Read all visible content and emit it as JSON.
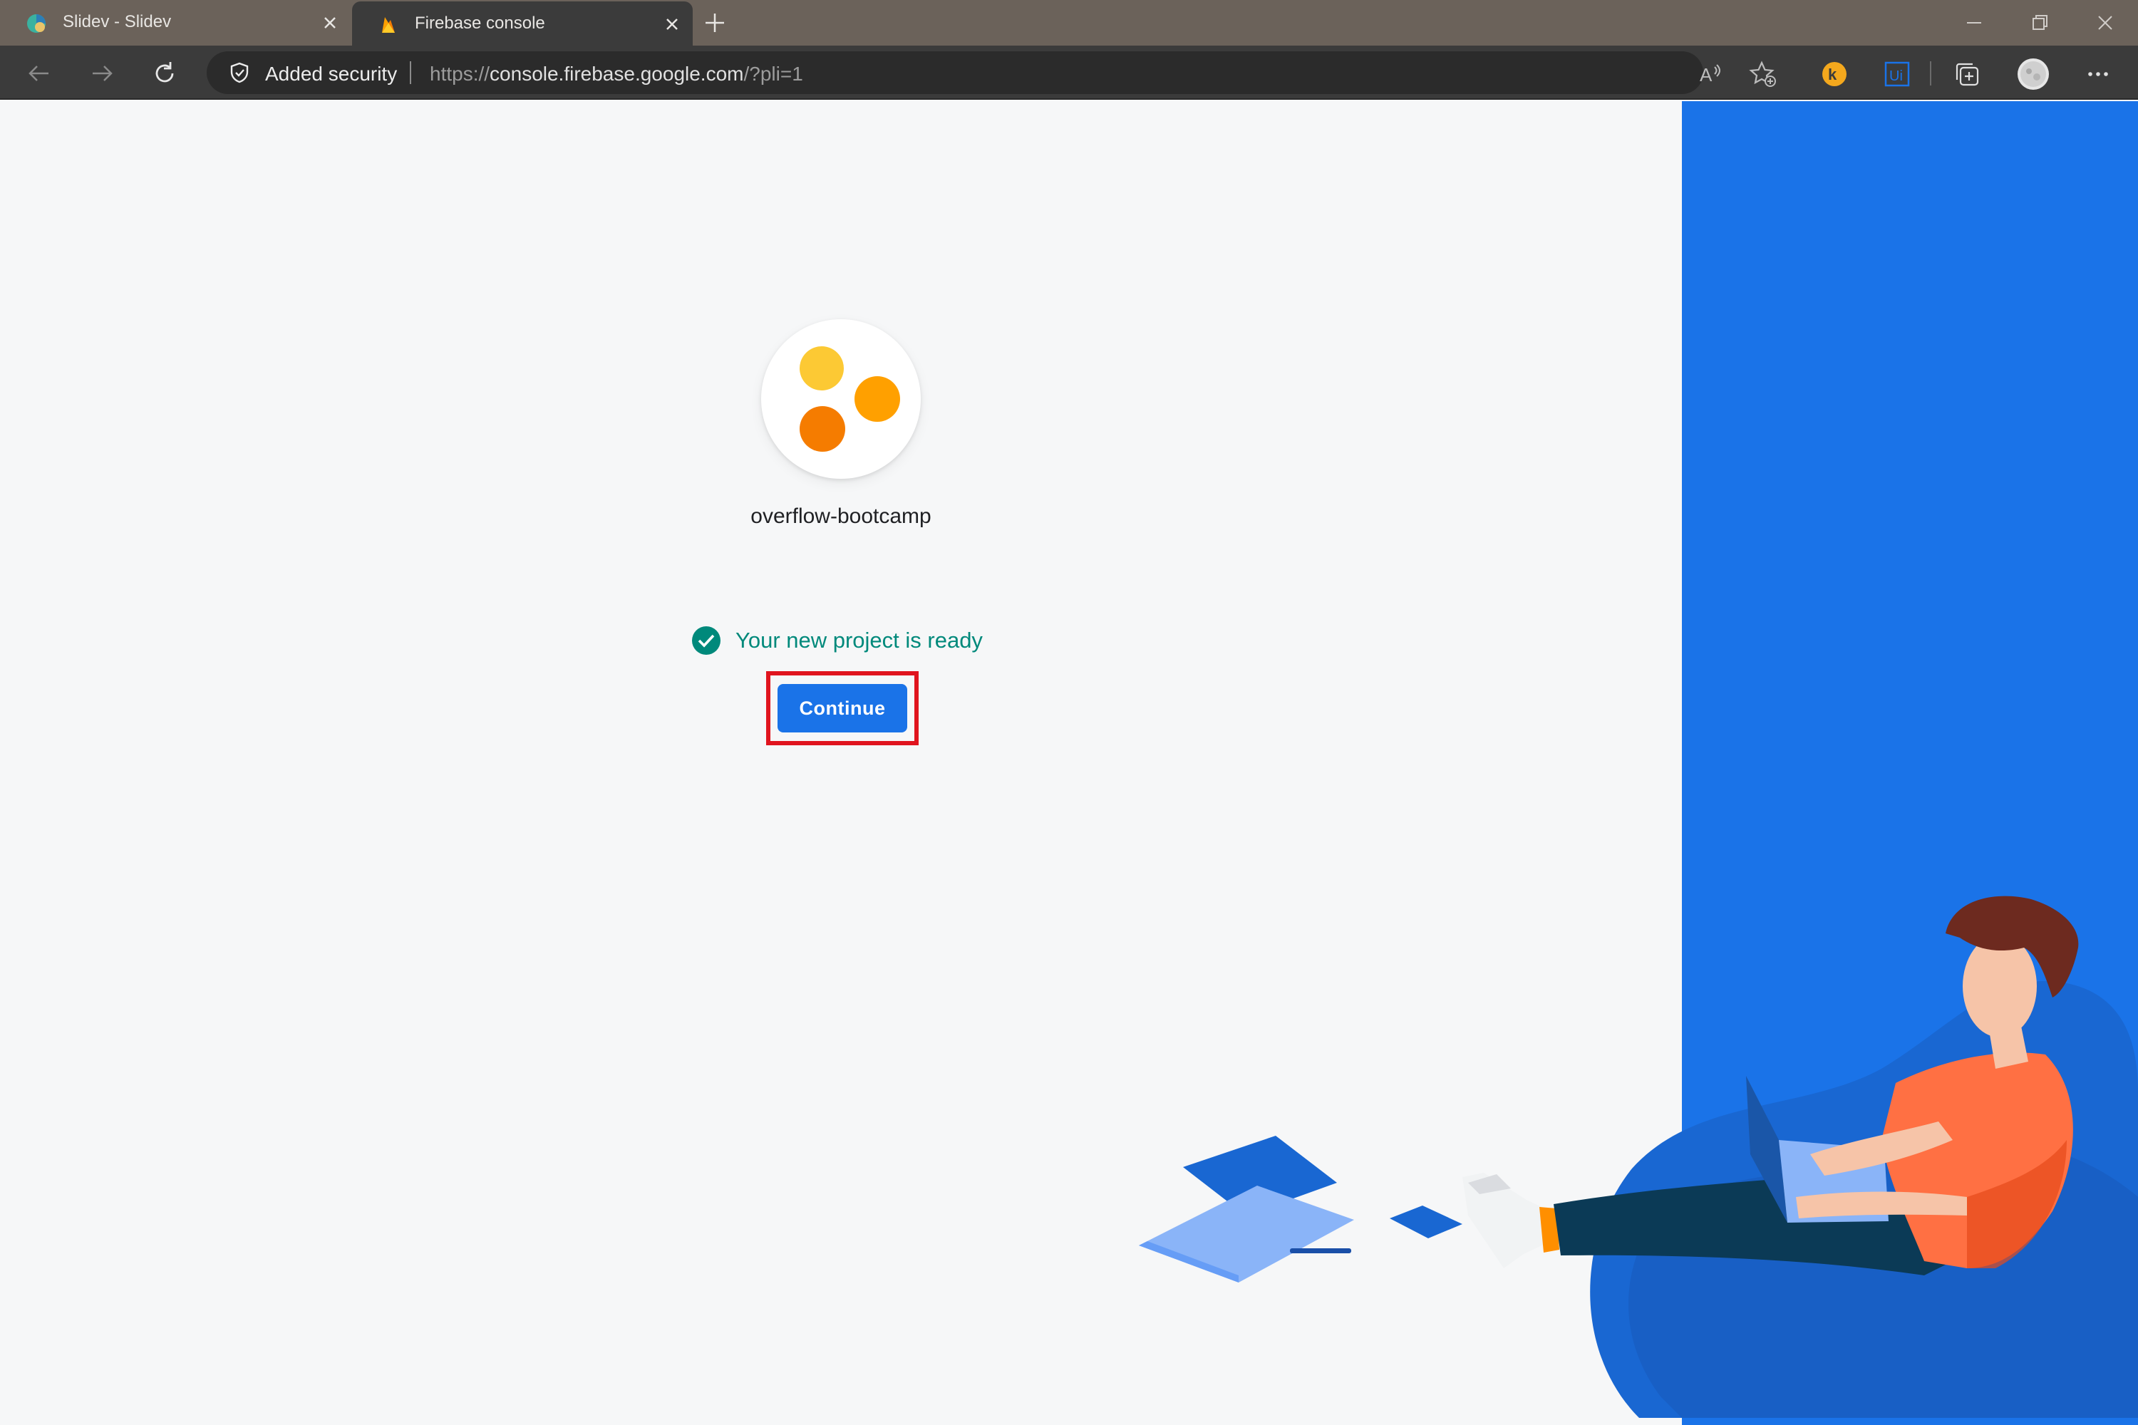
{
  "browser": {
    "tabs": [
      {
        "title": "Slidev - Slidev",
        "favicon": "slidev-icon",
        "active": false
      },
      {
        "title": "Firebase console",
        "favicon": "firebase-flame-icon",
        "active": true
      }
    ],
    "security_label": "Added security",
    "url": {
      "scheme": "https://",
      "host": "console.firebase.google.com",
      "path": "/?pli=1"
    },
    "toolbar_icons": [
      "read-aloud-icon",
      "favorites-add-icon",
      "extension-icon",
      "extension-ui-icon",
      "collections-icon",
      "profile-avatar",
      "more-icon"
    ]
  },
  "page": {
    "project_name": "overflow-bootcamp",
    "status_message": "Your new project is ready",
    "continue_label": "Continue"
  },
  "colors": {
    "accent_blue": "#1a73e8",
    "success_teal": "#00897b",
    "highlight_red": "#e0141e",
    "dot_yellow": "#fcc934",
    "dot_orange": "#ffa000",
    "dot_dark_orange": "#f57c00"
  }
}
